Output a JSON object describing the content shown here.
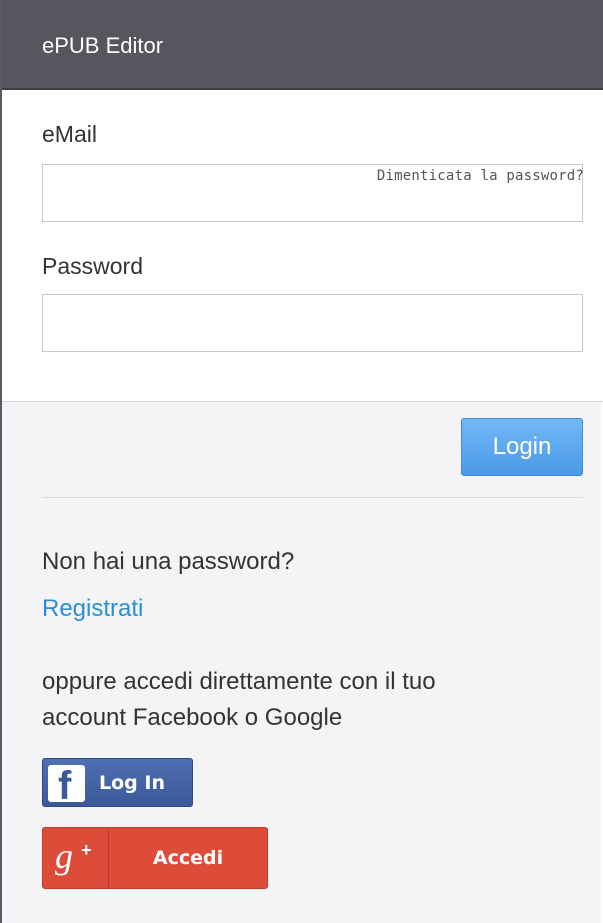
{
  "header": {
    "title": "ePUB Editor"
  },
  "form": {
    "email_label": "eMail",
    "email_value": "",
    "password_label": "Password",
    "password_value": "",
    "forgot_password_link": "Dimenticata la password?"
  },
  "actions": {
    "login_label": "Login"
  },
  "signup": {
    "question": "Non hai una password?",
    "register_link": "Registrati",
    "social_text_line1": "oppure accedi direttamente con il tuo",
    "social_text_line2": "account Facebook o Google"
  },
  "social": {
    "facebook_icon_glyph": "f",
    "facebook_label": "Log In",
    "google_icon_glyph": "g",
    "google_plus_glyph": "+",
    "google_label": "Accedi"
  },
  "colors": {
    "header_bg": "#55565e",
    "link": "#2a8fd6",
    "login_button": "#4a9ae6",
    "facebook": "#3b5998",
    "google": "#dd4b39"
  },
  "icons": {
    "facebook": "facebook-icon",
    "google": "google-plus-icon"
  }
}
